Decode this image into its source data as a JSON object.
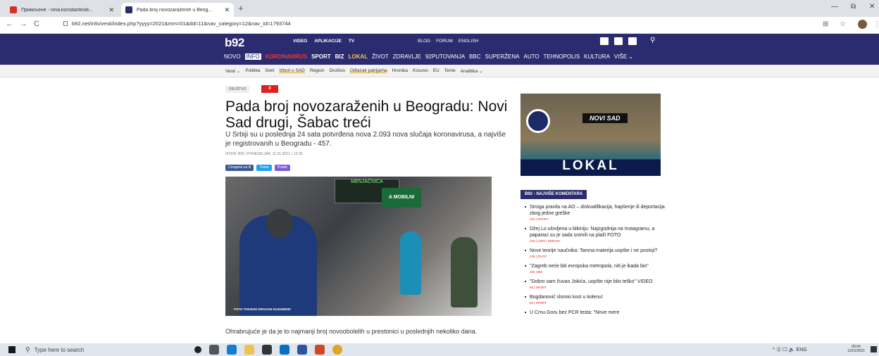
{
  "browser": {
    "tabs": [
      {
        "title": "Примљене - nina.konstantinidi..."
      },
      {
        "title": "Pada broj novozaraženih u Beog..."
      }
    ],
    "new_tab": "+",
    "url": "b92.net/info/vesti/index.php?yyyy=2021&mm=01&dd=11&nav_category=12&nav_id=1793744",
    "back": "←",
    "forward": "→",
    "reload": "C",
    "minimize": "—",
    "restore": "⧉",
    "close": "✕",
    "star": "☆",
    "more": "⋮",
    "translate": "⊞"
  },
  "site": {
    "logo": "b92",
    "top_links": [
      "VIDEO",
      "APLIKACIJE",
      "TV"
    ],
    "top_links2": [
      "BLOG",
      "FORUM",
      "ENGLISH"
    ],
    "categories": [
      "NOVO",
      "INFO",
      "KORONAVIRUS",
      "SPORT",
      "BIZ",
      "LOKAL",
      "ŽIVOT",
      "ZDRAVLJE",
      "92PUTOVANJA",
      "BBC",
      "SUPERŽENA",
      "AUTO",
      "TEHNOPOLIS",
      "KULTURA",
      "VIŠE ⌄"
    ],
    "subnav": [
      "Vesti ⌄",
      "Politika",
      "Svet",
      "Izbori u SAD",
      "Region",
      "Društvo",
      "Odlazak patrijarha",
      "Hronika",
      "Kosovo",
      "EU",
      "Teme",
      "Analitika ⌄"
    ]
  },
  "article": {
    "tag": "DRUŠTVO",
    "comments": "0",
    "headline": "Pada broj novozaraženih u Beogradu: Novi Sad drugi, Šabac treći",
    "lead": "U Srbiji su u poslednja 24 sata potvrđena nova 2.093 nova slučaja koronavirusa, a najviše je registrovanih u Beogradu - 457.",
    "meta": "IZVOR: B92 | PONEDELJAK, 11.01.2021. | 15:30",
    "share": [
      "Сподели на Ф",
      "Tweet",
      "Podeli"
    ],
    "photo_credit": "FOTO TANJUG/ DRAGAN KUJUNDZIC",
    "photo_sign": "MENJAČNICA",
    "photo_sign2": "A MOBILNI",
    "body": "Ohrabrujuće je da je to najmanji broj novoobolelih u prestonici u poslednjih nekoliko dana."
  },
  "sidebar": {
    "ad_city": "NOVI SAD",
    "ad_brand": "LOKAL",
    "section_title": "B92 - NAJVIŠE KOMENTARA",
    "items": [
      {
        "title": "Stroga pravila na AO – diskvalifikacija, hapšenje ili deportacija zbog jedne greške",
        "meta": "123 | SPORT"
      },
      {
        "title": "Džej Lo ulovljena u bikiniju: Najzgodnija na Instagramu, a paparaci su je sada snimili na plaži FOTO",
        "meta": "120 | LEPA I ZDRAVA"
      },
      {
        "title": "Nove teorije naučnika: Tamna materija uopšte i ne postoji?",
        "meta": "109 | ŽIVOT"
      },
      {
        "title": "\"Zagreb neće biti evropska metropola, niti je ikada bio\"",
        "meta": "104 | BIZ"
      },
      {
        "title": "\"Dobro sam čuvao Jokića, uopšte nije bilo teško\" VIDEO",
        "meta": "93 | SPORT"
      },
      {
        "title": "Bogdanović slomio kost u kolenu!",
        "meta": "83 | SPORT"
      },
      {
        "title": "U Crnu Goru bez PCR testa: \"Nove mere",
        "meta": ""
      }
    ]
  },
  "taskbar": {
    "search_placeholder": "Type here to search",
    "tray": "^ ⓖ 🖵 🔈 ENG",
    "time": "09:04",
    "date": "12/01/2021"
  }
}
